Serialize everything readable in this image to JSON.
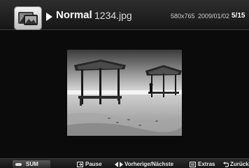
{
  "header": {
    "mode": "Normal",
    "filename": "1234.jpg",
    "resolution": "580x765",
    "date": "2009/01/02",
    "counter": "5/15"
  },
  "icons": {
    "app": "photo-viewer-icon",
    "play": "play-icon"
  },
  "photo": {
    "subject": "beach umbrellas photo"
  },
  "footer": {
    "sum_label": "SUM",
    "pause_label": "Pause",
    "nav_label": "Vorherige/Nächste",
    "extras_label": "Extras",
    "back_label": "Zurück"
  }
}
